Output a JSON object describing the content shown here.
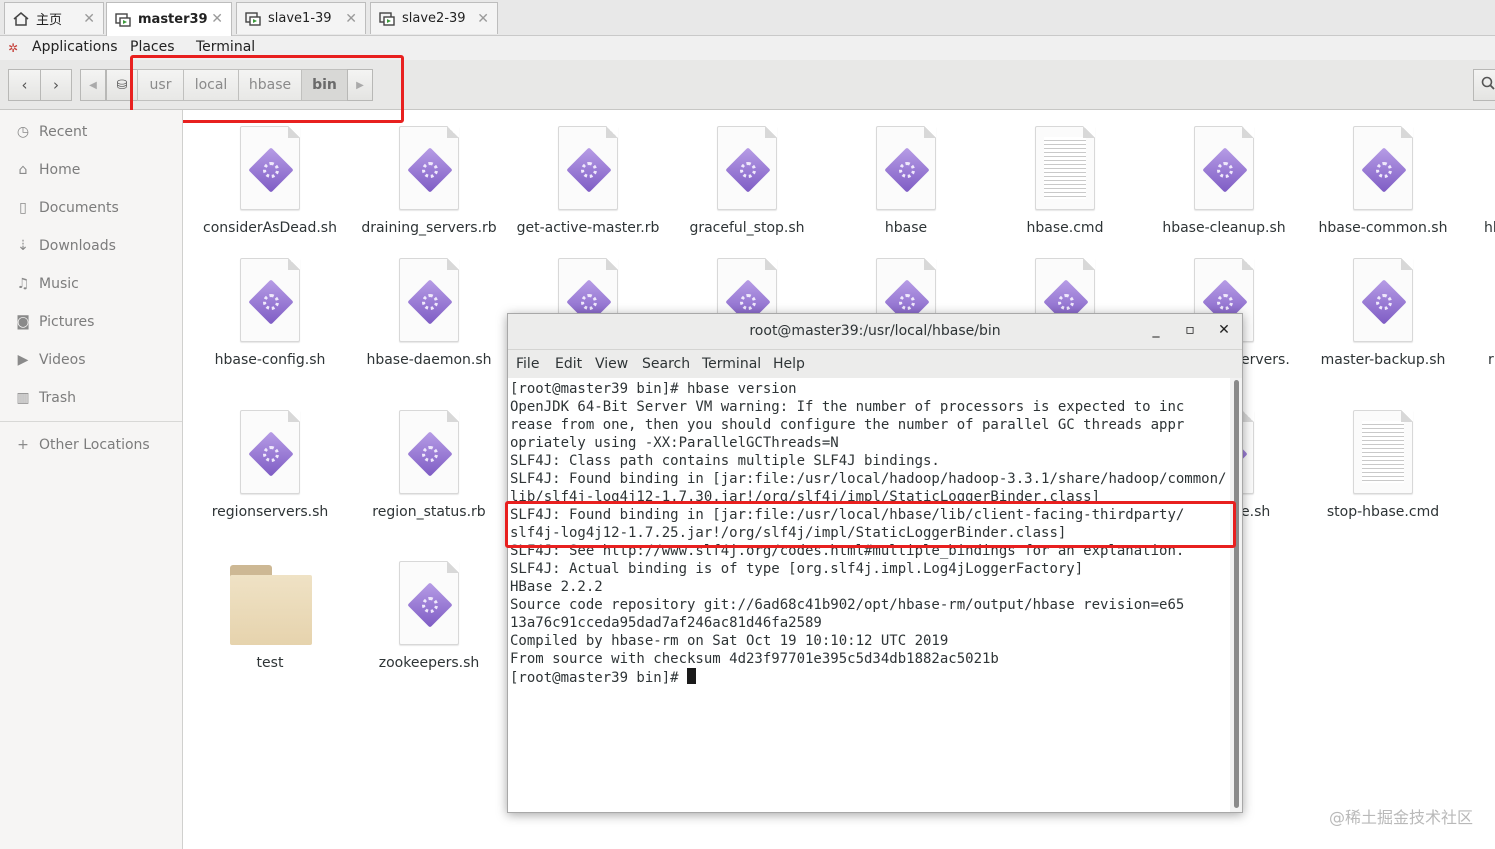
{
  "vm_tabs": [
    {
      "label": "主页",
      "icon": "home-icon"
    },
    {
      "label": "master39",
      "icon": "vm-icon"
    },
    {
      "label": "slave1-39",
      "icon": "vm-icon"
    },
    {
      "label": "slave2-39",
      "icon": "vm-icon"
    }
  ],
  "top_panel": {
    "applications": "Applications",
    "places": "Places",
    "terminal": "Terminal"
  },
  "path_bar": {
    "crumbs": [
      "usr",
      "local",
      "hbase",
      "bin"
    ],
    "current": "bin"
  },
  "sidebar": {
    "items": [
      {
        "label": "Recent",
        "icon": "clock-icon"
      },
      {
        "label": "Home",
        "icon": "home-icon"
      },
      {
        "label": "Documents",
        "icon": "document-icon"
      },
      {
        "label": "Downloads",
        "icon": "download-icon"
      },
      {
        "label": "Music",
        "icon": "music-icon"
      },
      {
        "label": "Pictures",
        "icon": "camera-icon"
      },
      {
        "label": "Videos",
        "icon": "video-icon"
      },
      {
        "label": "Trash",
        "icon": "trash-icon"
      }
    ],
    "other_locations": "Other Locations"
  },
  "files": {
    "row1": [
      "considerAsDead.sh",
      "draining_servers.rb",
      "get-active-master.rb",
      "graceful_stop.sh",
      "hbase",
      "hbase.cmd",
      "hbase-cleanup.sh",
      "hbase-common.sh",
      "hb"
    ],
    "row2_left": [
      "hbase-config.sh",
      "hbase-daemon.sh"
    ],
    "row2_right": [
      "ervers.",
      "master-backup.sh",
      "r"
    ],
    "row3_left": [
      "regionservers.sh",
      "region_status.rb"
    ],
    "row3_right": [
      "e.sh",
      "stop-hbase.cmd"
    ],
    "row4": [
      "test",
      "zookeepers.sh"
    ]
  },
  "terminal": {
    "title": "root@master39:/usr/local/hbase/bin",
    "menu": [
      "File",
      "Edit",
      "View",
      "Search",
      "Terminal",
      "Help"
    ],
    "lines": [
      "[root@master39 bin]# hbase version",
      "OpenJDK 64-Bit Server VM warning: If the number of processors is expected to inc",
      "rease from one, then you should configure the number of parallel GC threads appr",
      "opriately using -XX:ParallelGCThreads=N",
      "SLF4J: Class path contains multiple SLF4J bindings.",
      "SLF4J: Found binding in [jar:file:/usr/local/hadoop/hadoop-3.3.1/share/hadoop/common/",
      "lib/slf4j-log4j12-1.7.30.jar!/org/slf4j/impl/StaticLoggerBinder.class]",
      "SLF4J: Found binding in [jar:file:/usr/local/hbase/lib/client-facing-thirdparty/",
      "slf4j-log4j12-1.7.25.jar!/org/slf4j/impl/StaticLoggerBinder.class]",
      "SLF4J: See http://www.slf4j.org/codes.html#multiple_bindings for an explanation.",
      "SLF4J: Actual binding is of type [org.slf4j.impl.Log4jLoggerFactory]",
      "HBase 2.2.2",
      "Source code repository git://6ad68c41b902/opt/hbase-rm/output/hbase revision=e65",
      "13a76c91cceda95dad7af246ac81d46fa2589",
      "Compiled by hbase-rm on Sat Oct 19 10:10:12 UTC 2019",
      "From source with checksum 4d23f97701e395c5d34db1882ac5021b",
      "[root@master39 bin]# "
    ]
  },
  "watermark": "@稀土掘金技术社区",
  "colors": {
    "highlight_box": "#e8201f",
    "icon_accent": "#8e6fd0",
    "folder": "#e6d3ad"
  }
}
